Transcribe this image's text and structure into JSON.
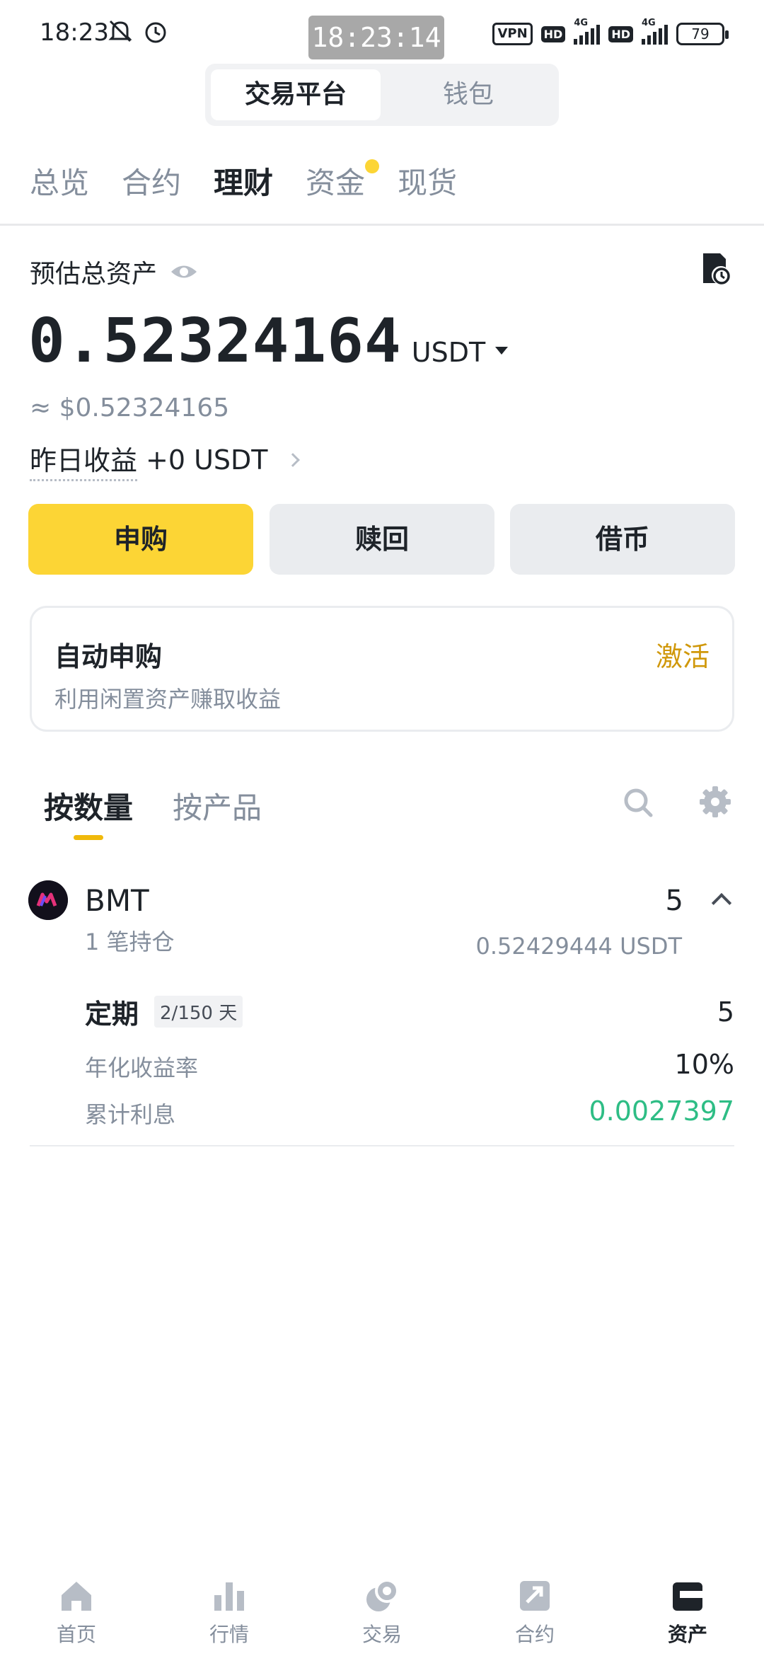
{
  "status_bar": {
    "time": "18:23",
    "clock_overlay": "18:23:14",
    "vpn": "VPN",
    "hd1": "HD",
    "hd2": "HD",
    "net1": "4G",
    "net2": "4G",
    "battery": "79"
  },
  "segment": {
    "active": "交易平台",
    "inactive": "钱包"
  },
  "tabs": [
    "总览",
    "合约",
    "理财",
    "资金",
    "现货"
  ],
  "balance": {
    "label": "预估总资产",
    "value": "0.52324164",
    "unit": "USDT",
    "fiat": "≈ $0.52324165",
    "yesterday_label": "昨日收益",
    "yesterday_value": "+0 USDT"
  },
  "actions": {
    "buy": "申购",
    "redeem": "赎回",
    "borrow": "借币"
  },
  "auto_card": {
    "title": "自动申购",
    "subtitle": "利用闲置资产赚取收益",
    "action": "激活"
  },
  "holding_tabs": [
    "按数量",
    "按产品"
  ],
  "asset": {
    "name": "BMT",
    "positions": "1 笔持仓",
    "amount": "5",
    "value": "0.52429444 USDT",
    "detail": {
      "type": "定期",
      "term": "2/150 天",
      "amount": "5",
      "apr_label": "年化收益率",
      "apr": "10%",
      "interest_label": "累计利息",
      "interest": "0.0027397"
    }
  },
  "bottom_nav": [
    "首页",
    "行情",
    "交易",
    "合约",
    "资产"
  ],
  "colors": {
    "brand_yellow": "#fcd535",
    "accent_text": "#d0980b",
    "profit_green": "#2ebd85",
    "muted": "#848e9c"
  }
}
